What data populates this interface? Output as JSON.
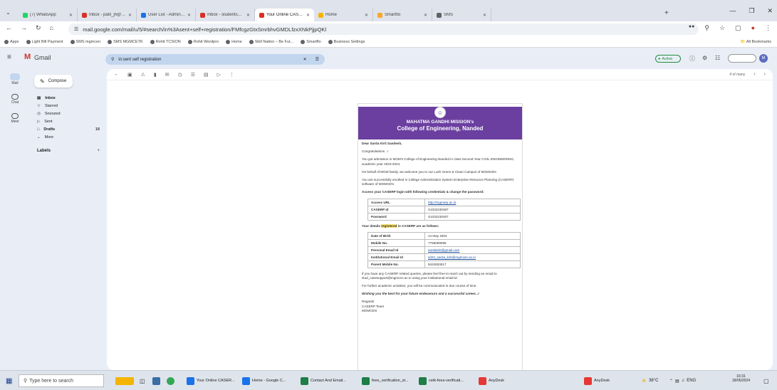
{
  "browser": {
    "tabs": [
      {
        "title": "(7) WhatsApp",
        "color": "#25d366"
      },
      {
        "title": "Inbox - patil_jh@mgmce·",
        "color": "#d93025"
      },
      {
        "title": "User List - Admin Console",
        "color": "#1a73e8"
      },
      {
        "title": "Inbox - studentsupport@",
        "color": "#d93025"
      },
      {
        "title": "Your Online CASERP Self",
        "color": "#d93025",
        "active": true
      },
      {
        "title": "Home",
        "color": "#f4b400"
      },
      {
        "title": "Smartflo",
        "color": "#f9a825"
      },
      {
        "title": "SMS",
        "color": "#5f6368"
      }
    ],
    "url": "mail.google.com/mail/u/5/#search/in%3Asent+self+registration/FMfcgzGtxSmrbhvGMDLfzxXNkPjjpQKl",
    "bookmarks": [
      "Apps",
      "Light Bill Payment",
      "SMS mgmcen",
      "SMS MGMCETK",
      "Rohit TCSION",
      "Rohit Wordpro",
      "Home",
      "Skill Nation – Be Fut...",
      "Smartflo",
      "Business Settings"
    ],
    "all_bookmarks": "All Bookmarks"
  },
  "gmail": {
    "brand": "Gmail",
    "search_value": "in:sent self registration",
    "status": "Active",
    "pager": "4 of many",
    "rail": [
      "Mail",
      "Chat",
      "Meet"
    ],
    "compose": "Compose",
    "nav": [
      {
        "label": "Inbox",
        "count": ""
      },
      {
        "label": "Starred",
        "count": ""
      },
      {
        "label": "Snoozed",
        "count": ""
      },
      {
        "label": "Sent",
        "count": ""
      },
      {
        "label": "Drafts",
        "count": "18"
      },
      {
        "label": "More",
        "count": ""
      }
    ],
    "labels_heading": "Labels"
  },
  "email": {
    "org_line1": "MAHATMA GANDHI MISSION's",
    "org_line2": "College of Engineering, Nanded",
    "greeting": "Dear Sarda Kirit Sandesh,",
    "congrats": "Congratulations ..!",
    "p1": "You got admission in MGM's College of Engineering Nanded in class Second Year CIVIL ENGINEERING, academic year 2023-2024.",
    "p2": "On behalf of MGM family, we welcome you to our Lush Green & Clean Campus of MGMCEN.",
    "p3": "You are successfully enrolled in College Administration System Enterprise Resource Planning (CASERP) software of MGMCEN.",
    "cred_heading": "Access your CASERP login with following credentials & change the password:",
    "credentials": [
      {
        "k": "Access URL",
        "v": "http://mgmerp.ac.in"
      },
      {
        "k": "CASERP Id",
        "v": "S1032230487"
      },
      {
        "k": "Password",
        "v": "S1032230487"
      }
    ],
    "details_heading_pre": "Your details ",
    "details_heading_hl": "registered",
    "details_heading_post": " in CASERP are as follows:",
    "details": [
      {
        "k": "Date of Birth",
        "v": "14 May 2004"
      },
      {
        "k": "Mobile No.",
        "v": "7758089095"
      },
      {
        "k": "Personal Email Id",
        "v": "sardakirit@gmail.com"
      },
      {
        "k": "Institutional Email Id",
        "v": "sd23_sarda_kirit@mgmcen.ac.in"
      },
      {
        "k": "Parent Mobile No.",
        "v": "9422820817"
      }
    ],
    "p4": "If you have any CASERP related queries, please feel free to reach out by sending an email to stud_casesupport@mgmcen.ac.in using your institutional email-id.",
    "p5": "For further academic activities, you will be communicated in due course of time.",
    "p6": "Wishing you the best for your future endeavours and a successful career...!",
    "sign1": "Regards",
    "sign2": "CASERP Team",
    "sign3": "MGMCEN"
  },
  "taskbar": {
    "search": "Type here to search",
    "apps": [
      {
        "label": "Your Online CASER...",
        "color": "#1a73e8"
      },
      {
        "label": "Home - Google C...",
        "color": "#1a73e8"
      },
      {
        "label": "Contact And Email...",
        "color": "#1e7e45"
      },
      {
        "label": "fees_verification_st...",
        "color": "#1e7e45"
      },
      {
        "label": "cetk-fees-verificati...",
        "color": "#1e7e45"
      },
      {
        "label": "AnyDesk",
        "color": "#e53935"
      },
      {
        "label": "AnyDesk",
        "color": "#e53935"
      }
    ],
    "weather": "38°C",
    "lang": "ENG",
    "time": "16:31",
    "date": "18/05/2024"
  }
}
